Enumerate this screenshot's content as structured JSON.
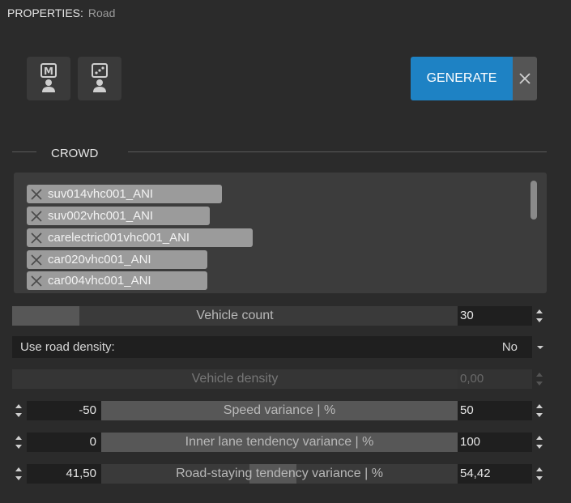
{
  "header": {
    "label": "PROPERTIES:",
    "value": "Road"
  },
  "toolbar": {
    "mode_buttons": [
      {
        "name": "manual-mode",
        "glyph": "M"
      },
      {
        "name": "random-mode",
        "glyph": "dice"
      }
    ],
    "generate_label": "GENERATE"
  },
  "crowd": {
    "title": "CROWD",
    "items": [
      "suv014vhc001_ANI",
      "suv002vhc001_ANI",
      "carelectric001vhc001_ANI",
      "car020vhc001_ANI",
      "car004vhc001_ANI"
    ]
  },
  "vehicle_count": {
    "label": "Vehicle count",
    "value": "30",
    "fill_fraction": 0.15
  },
  "road_density": {
    "label": "Use road density:",
    "value": "No"
  },
  "vehicle_density": {
    "label": "Vehicle density",
    "value": "0,00"
  },
  "speed_variance": {
    "label": "Speed variance | %",
    "min": "-50",
    "max": "50"
  },
  "inner_lane": {
    "label": "Inner lane tendency variance | %",
    "min": "0",
    "max": "100"
  },
  "road_staying": {
    "label": "Road-staying tendency variance | %",
    "min": "41,50",
    "max": "54,42"
  },
  "colors": {
    "accent": "#1e82c4",
    "background": "#2b2b2b",
    "chip": "#9b9b9b"
  }
}
